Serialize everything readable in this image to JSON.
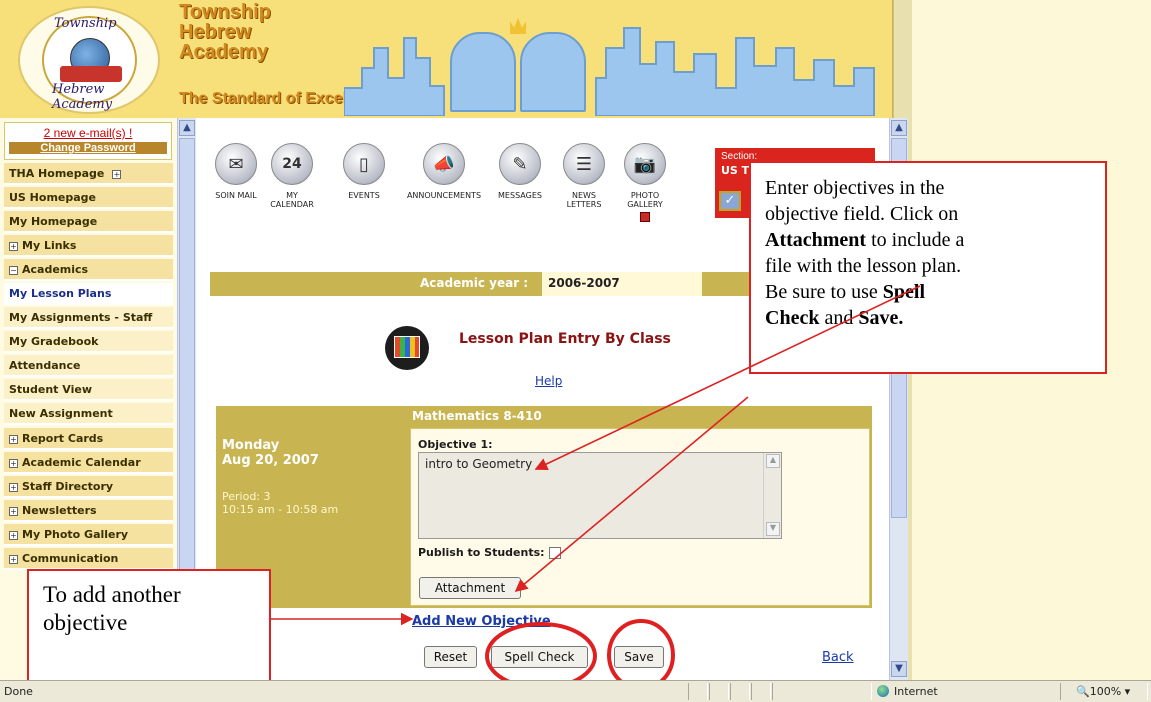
{
  "school": {
    "logo_text_top": "Township",
    "logo_text_bottom": "Hebrew Academy",
    "name_line1": "Township",
    "name_line2": "Hebrew",
    "name_line3": "Academy",
    "tagline": "The Standard of Excellence"
  },
  "sidebar": {
    "email_alert": "2 new e-mail(s) !",
    "change_password": "Change Password",
    "items": [
      {
        "label": "THA Homepage",
        "toggle": "+"
      },
      {
        "label": "US Homepage",
        "toggle": ""
      },
      {
        "label": "My Homepage",
        "toggle": ""
      },
      {
        "label": "My Links",
        "toggle": "+"
      },
      {
        "label": "Academics",
        "toggle": "−"
      },
      {
        "label": "My Lesson Plans",
        "toggle": ""
      },
      {
        "label": "My Assignments - Staff",
        "toggle": ""
      },
      {
        "label": "My Gradebook",
        "toggle": ""
      },
      {
        "label": "Attendance",
        "toggle": ""
      },
      {
        "label": "Student View",
        "toggle": ""
      },
      {
        "label": "New Assignment",
        "toggle": ""
      },
      {
        "label": "Report Cards",
        "toggle": "+"
      },
      {
        "label": "Academic Calendar",
        "toggle": "+"
      },
      {
        "label": "Staff Directory",
        "toggle": "+"
      },
      {
        "label": "Newsletters",
        "toggle": "+"
      },
      {
        "label": "My Photo Gallery",
        "toggle": "+"
      },
      {
        "label": "Communication",
        "toggle": "+"
      }
    ]
  },
  "toolbar": {
    "icons": [
      {
        "label": "SOIN MAIL",
        "icon": "mail-icon"
      },
      {
        "label": "MY CALENDAR",
        "icon": "calendar-icon",
        "calendar_day": "24"
      },
      {
        "label": "EVENTS",
        "icon": "pda-icon"
      },
      {
        "label": "ANNOUNCEMENTS",
        "icon": "megaphone-icon"
      },
      {
        "label": "MESSAGES",
        "icon": "message-icon"
      },
      {
        "label": "NEWS LETTERS",
        "icon": "newsletter-icon"
      },
      {
        "label": "PHOTO GALLERY",
        "icon": "camera-icon"
      }
    ]
  },
  "section": {
    "label": "Section:",
    "value": "US T"
  },
  "academic_year": {
    "label": "Academic year :",
    "value": "2006-2007"
  },
  "page": {
    "title": "Lesson Plan Entry By Class",
    "help": "Help"
  },
  "lesson_plan": {
    "class_name": "Mathematics 8-410",
    "day": "Monday",
    "date": "Aug 20, 2007",
    "period": "Period: 3",
    "time": "10:15 am - 10:58 am",
    "objective_label": "Objective 1:",
    "objective_text": "intro to Geometry",
    "publish_label": "Publish to Students:",
    "attachment_button": "Attachment",
    "add_objective_link": "Add New Objective",
    "reset_button": "Reset",
    "spell_check_button": "Spell Check",
    "save_button": "Save",
    "back_link": "Back"
  },
  "callouts": {
    "main_line1": "Enter objectives in the",
    "main_line2": "objective field.  Click on",
    "main_attachment": "Attachment",
    "main_line3": " to include a",
    "main_line4": "file with the lesson plan.",
    "main_line5": "Be sure to use ",
    "main_spell": "Spell",
    "main_check": "Check",
    "main_and": " and ",
    "main_save": "Save.",
    "add_line1": "To add another",
    "add_line2": "objective"
  },
  "statusbar": {
    "status": "Done",
    "zone": "Internet",
    "zoom": "100%"
  },
  "colors": {
    "header_yellow": "#f7e07a",
    "table_gold": "#c9b452",
    "callout_red": "#dd2222",
    "link_blue": "#1a3aa6"
  }
}
